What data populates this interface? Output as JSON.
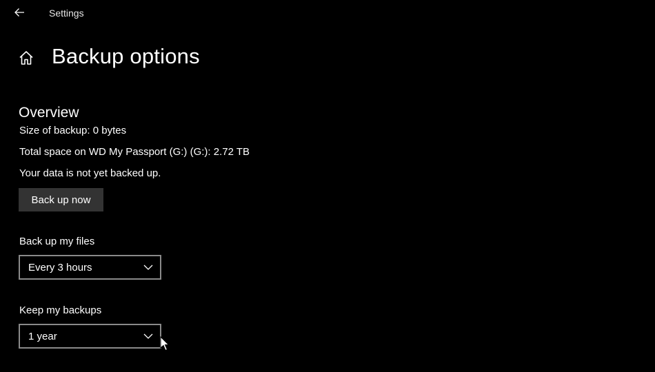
{
  "window": {
    "app_title": "Settings"
  },
  "page": {
    "title": "Backup options"
  },
  "overview": {
    "heading": "Overview",
    "size_of_backup": "Size of backup: 0 bytes",
    "total_space": "Total space on WD My Passport (G:) (G:): 2.72 TB",
    "status": "Your data is not yet backed up.",
    "back_up_now_label": "Back up now"
  },
  "backup_frequency": {
    "label": "Back up my files",
    "selected": "Every 3 hours"
  },
  "keep_backups": {
    "label": "Keep my backups",
    "selected": "1 year"
  },
  "icons": {
    "back": "back-arrow-icon",
    "home": "home-icon",
    "dropdown": "chevron-down-icon",
    "pointer": "mouse-pointer-icon"
  },
  "colors": {
    "background": "#000000",
    "text": "#ffffff",
    "button_bg": "#333333",
    "dropdown_border": "#8a8a8a"
  }
}
